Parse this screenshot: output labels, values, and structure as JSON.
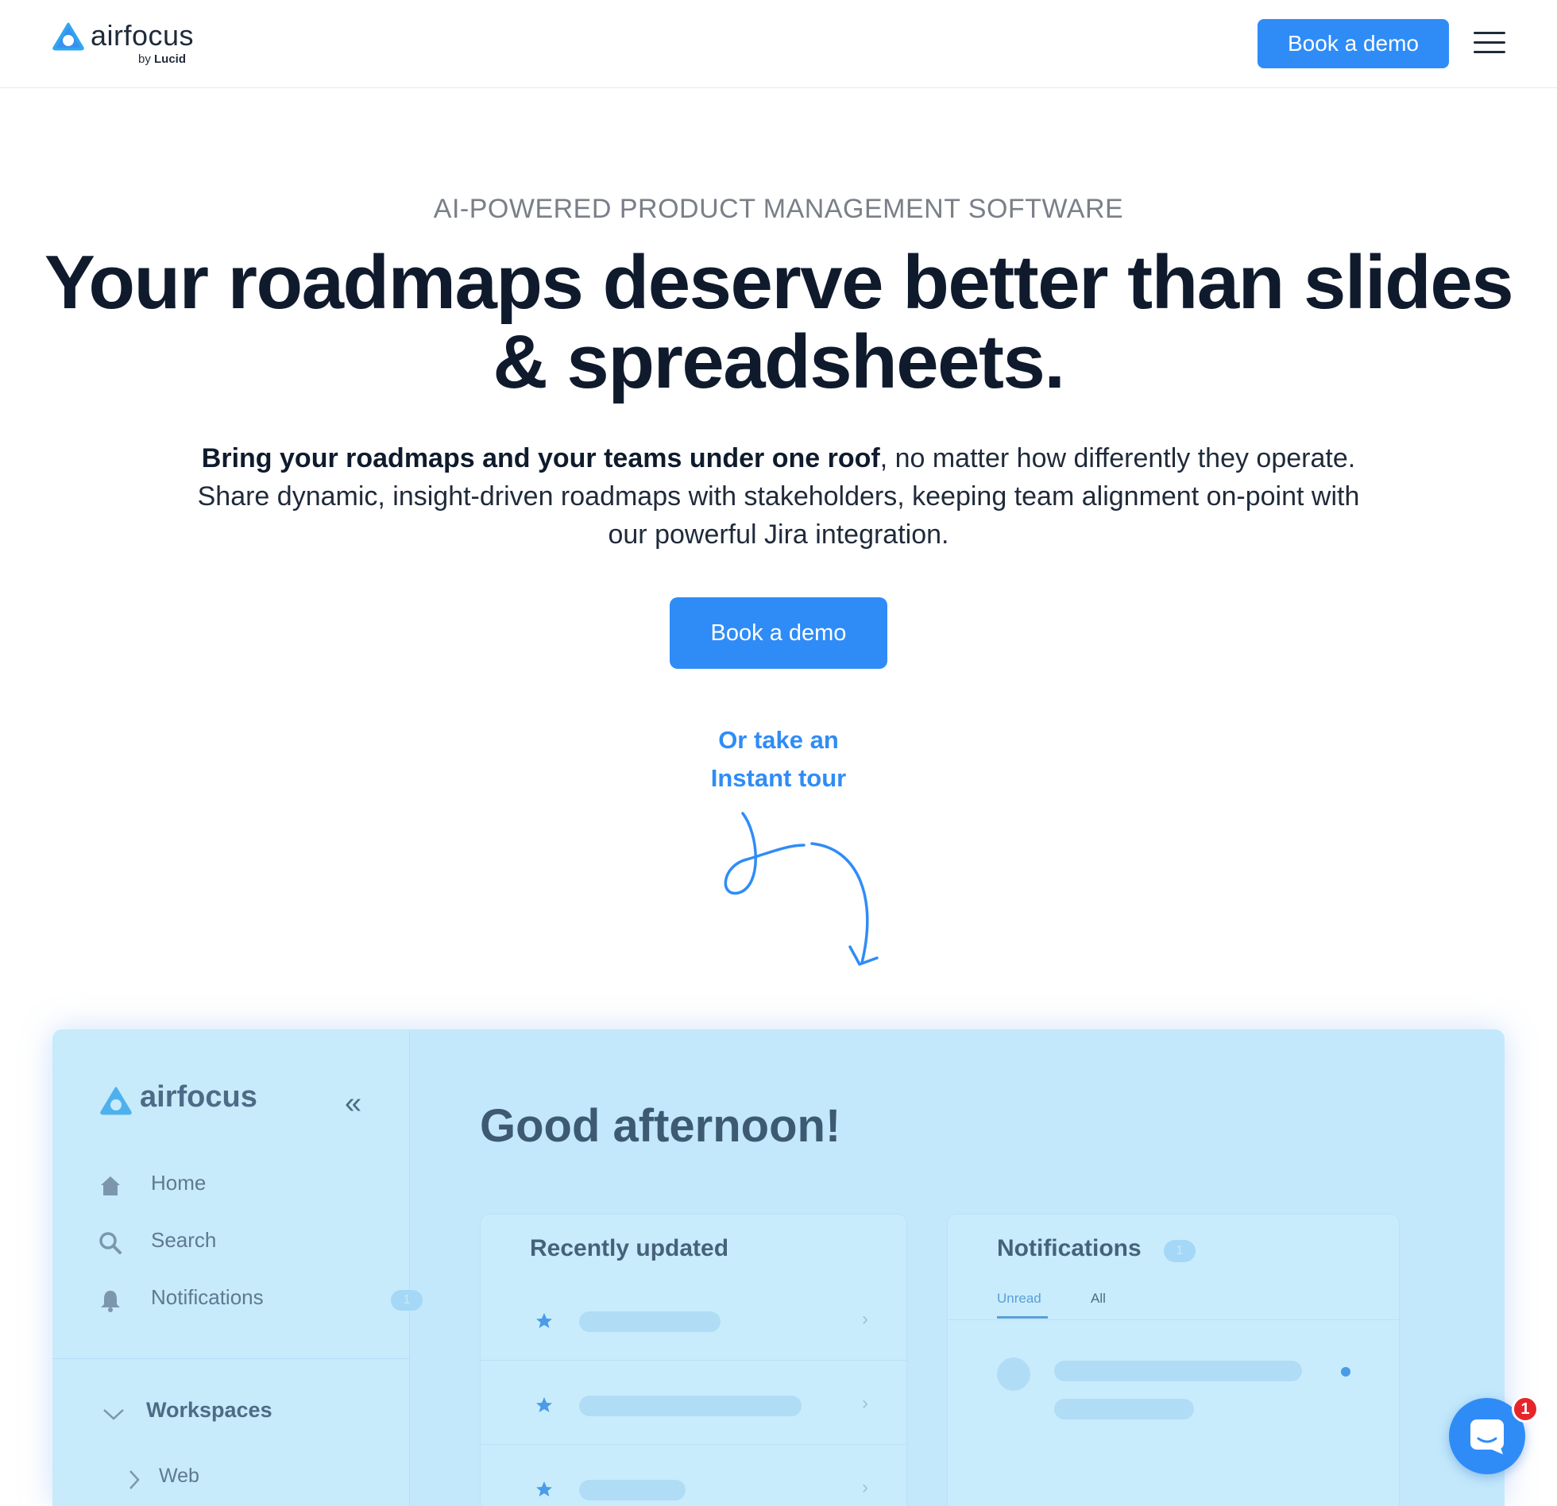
{
  "header": {
    "logo_text": "airfocus",
    "logo_by": "by",
    "logo_lucid": "Lucid",
    "cta_label": "Book a demo"
  },
  "hero": {
    "eyebrow": "AI-POWERED PRODUCT MANAGEMENT SOFTWARE",
    "headline_line1": "Your roadmaps deserve better than slides",
    "headline_line2": "& spreadsheets.",
    "subtext_bold": "Bring your roadmaps and your teams under one roof",
    "subtext_rest": ", no matter how differently they operate. Share dynamic, insight-driven roadmaps with stakeholders, keeping team alignment on-point with our powerful Jira integration.",
    "cta_label": "Book a demo",
    "tour_line1": "Or take an",
    "tour_line2": "Instant tour"
  },
  "preview": {
    "logo_text": "airfocus",
    "collapse_glyph": "«",
    "nav": [
      {
        "label": "Home",
        "icon": "home-icon"
      },
      {
        "label": "Search",
        "icon": "search-icon"
      },
      {
        "label": "Notifications",
        "icon": "bell-icon",
        "badge": "1"
      }
    ],
    "workspaces_label": "Workspaces",
    "workspace_item": "Web",
    "greeting": "Good afternoon!",
    "recent_title": "Recently updated",
    "notif_title": "Notifications",
    "notif_badge": "1",
    "tab_unread": "Unread",
    "tab_all": "All"
  },
  "chat": {
    "badge": "1",
    "icon": "chat-icon"
  },
  "colors": {
    "brand_blue": "#2f8cf7",
    "headline": "#0f1b2d",
    "preview_bg": "#c3e8fb"
  }
}
